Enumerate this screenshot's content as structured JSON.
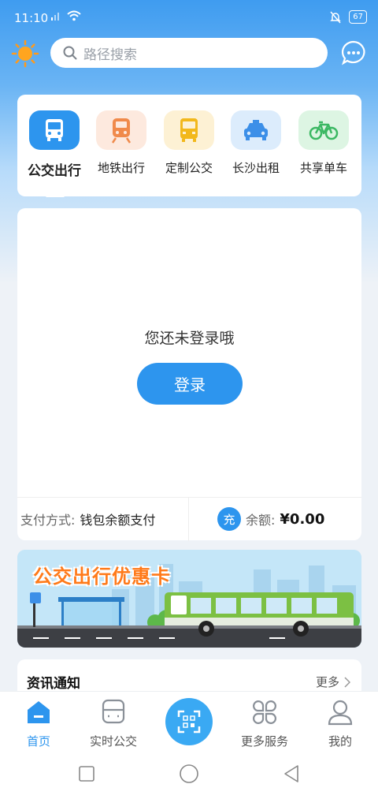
{
  "status_bar": {
    "time": "11:10",
    "battery": "67"
  },
  "header": {
    "search_placeholder": "路径搜索"
  },
  "nav": {
    "items": [
      {
        "label": "公交出行",
        "icon": "bus-icon",
        "bg": "#2d95ee",
        "fg": "#ffffff"
      },
      {
        "label": "地铁出行",
        "icon": "metro-icon",
        "bg": "#fde9de",
        "fg": "#f08a4b"
      },
      {
        "label": "定制公交",
        "icon": "custom-bus-icon",
        "bg": "#fdf1d4",
        "fg": "#f2b81c"
      },
      {
        "label": "长沙出租",
        "icon": "taxi-icon",
        "bg": "#dcecfc",
        "fg": "#3c8fe8"
      },
      {
        "label": "共享单车",
        "icon": "bicycle-icon",
        "bg": "#ddf5e3",
        "fg": "#3bb863"
      }
    ]
  },
  "main": {
    "login_hint": "您还未登录哦",
    "login_button": "登录",
    "pay_method_label": "支付方式:",
    "pay_method_value": "钱包余额支付",
    "charge_label": "充",
    "balance_label": "余额:",
    "balance_value": "¥0.00"
  },
  "banner": {
    "title": "公交出行优惠卡"
  },
  "news": {
    "title": "资讯通知",
    "more": "更多"
  },
  "tabbar": {
    "home": "首页",
    "realtime": "实时公交",
    "more_services": "更多服务",
    "mine": "我的"
  },
  "colors": {
    "accent": "#2d95ee"
  }
}
